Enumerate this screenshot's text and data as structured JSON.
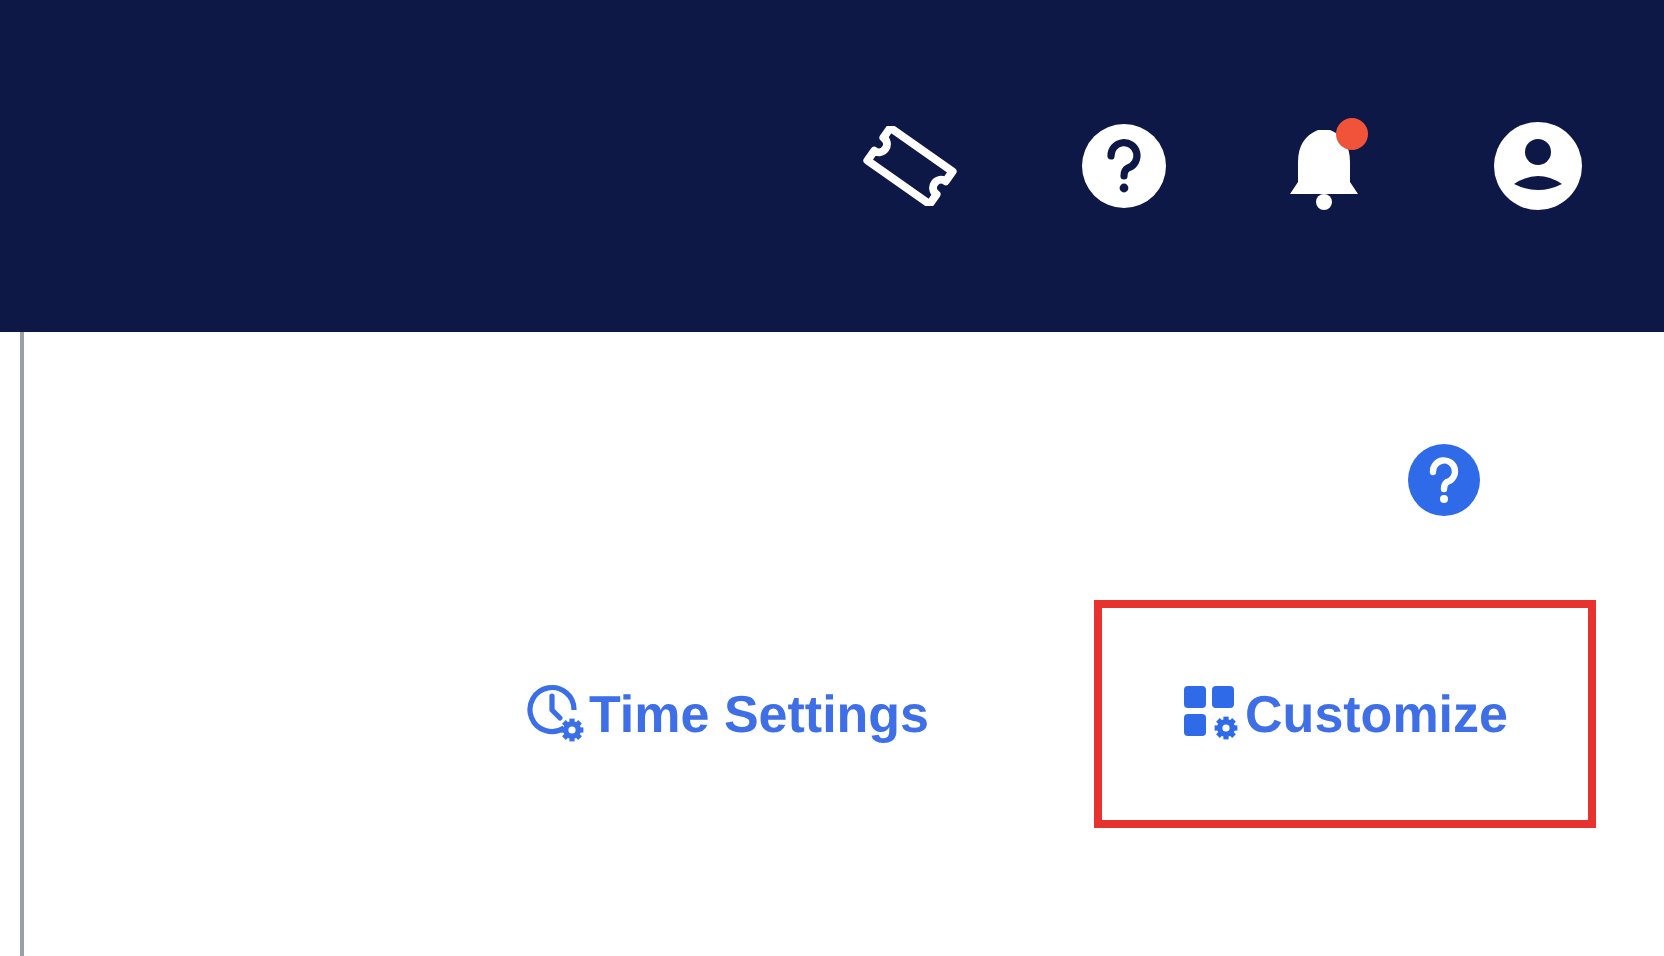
{
  "top_bar": {
    "notifications_unread": true
  },
  "toolbar": {
    "buttons": [
      {
        "kind": "time",
        "label": "Time Settings",
        "highlighted": false
      },
      {
        "kind": "customize",
        "label": "Customize",
        "highlighted": true
      }
    ]
  }
}
